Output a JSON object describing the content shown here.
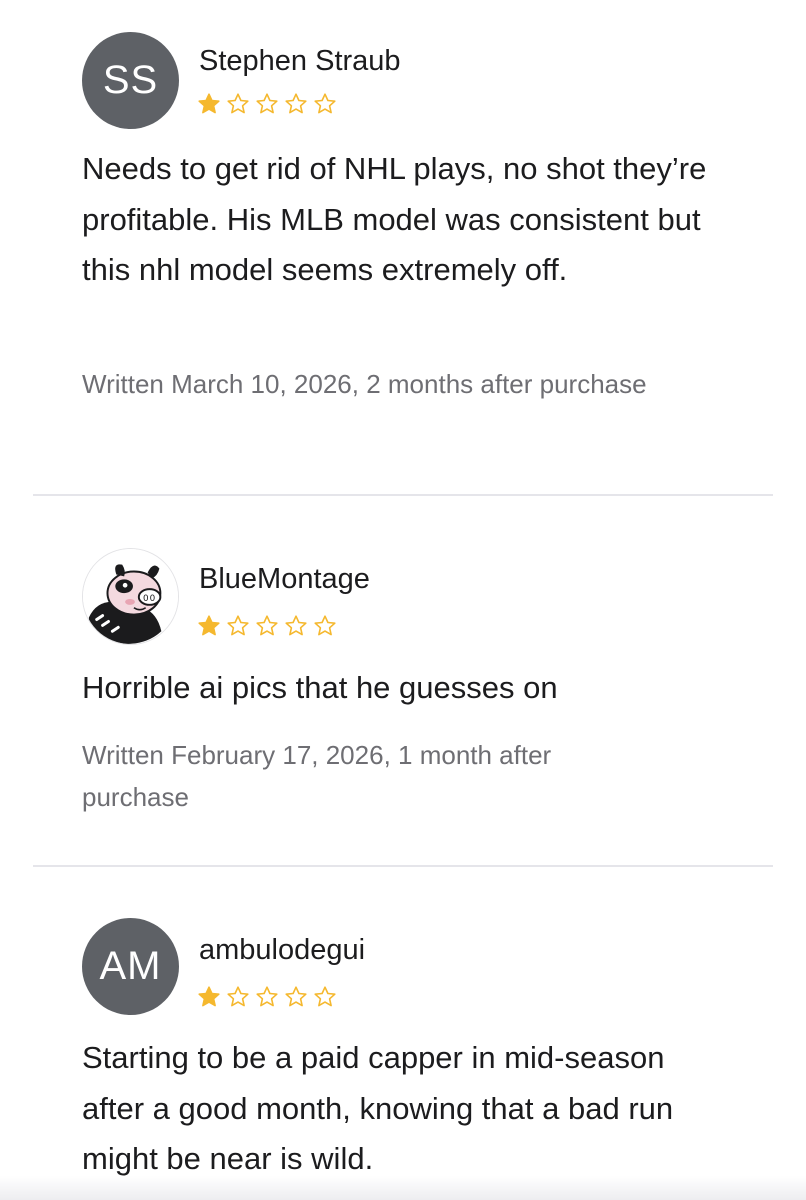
{
  "reviews": [
    {
      "avatar_initials": "SS",
      "avatar_type": "initials",
      "name": "Stephen Straub",
      "rating": 1,
      "rating_max": 5,
      "body": "Needs to get rid of NHL plays, no shot they’re profitable. His MLB model was consistent but this nhl model seems extremely off.",
      "meta": "Written March 10, 2026, 2 months after purchase"
    },
    {
      "avatar_type": "image",
      "avatar_icon": "cartoon-pig-avatar-icon",
      "name": "BlueMontage",
      "rating": 1,
      "rating_max": 5,
      "body": "Horrible ai pics that he guesses on",
      "meta": "Written February 17, 2026, 1 month after purchase"
    },
    {
      "avatar_initials": "AM",
      "avatar_type": "initials",
      "name": "ambulodegui",
      "rating": 1,
      "rating_max": 5,
      "body": "Starting to be a paid capper in mid-season after a good month, knowing that a bad run might be near is wild."
    }
  ],
  "colors": {
    "star_fill": "#f5b82e",
    "avatar_bg": "#5e6166",
    "divider": "#e5e5ea",
    "meta_text": "#6e6e73"
  }
}
